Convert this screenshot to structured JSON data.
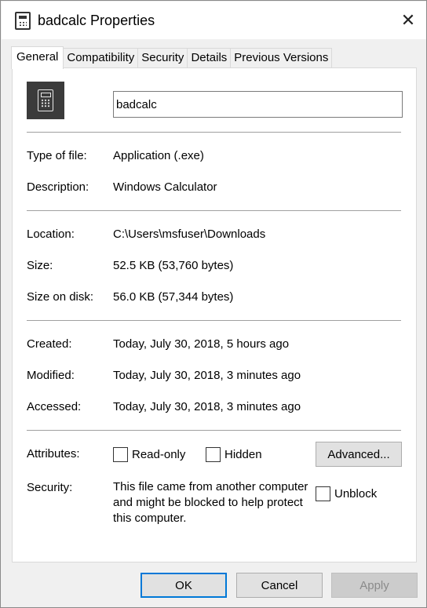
{
  "window": {
    "title": "badcalc Properties",
    "close_symbol": "✕"
  },
  "tabs": [
    {
      "label": "General",
      "active": true
    },
    {
      "label": "Compatibility",
      "active": false
    },
    {
      "label": "Security",
      "active": false
    },
    {
      "label": "Details",
      "active": false
    },
    {
      "label": "Previous Versions",
      "active": false
    }
  ],
  "general": {
    "file_name": "badcalc",
    "file_icon": "calculator-icon",
    "type_of_file": {
      "label": "Type of file:",
      "value": "Application (.exe)"
    },
    "description": {
      "label": "Description:",
      "value": "Windows Calculator"
    },
    "location": {
      "label": "Location:",
      "value": "C:\\Users\\msfuser\\Downloads"
    },
    "size": {
      "label": "Size:",
      "value": "52.5 KB (53,760 bytes)"
    },
    "size_on_disk": {
      "label": "Size on disk:",
      "value": "56.0 KB (57,344 bytes)"
    },
    "created": {
      "label": "Created:",
      "value": "Today, July 30, 2018, 5 hours ago"
    },
    "modified": {
      "label": "Modified:",
      "value": "Today, July 30, 2018, 3 minutes ago"
    },
    "accessed": {
      "label": "Accessed:",
      "value": "Today, July 30, 2018, 3 minutes ago"
    },
    "attributes": {
      "label": "Attributes:",
      "read_only": {
        "label": "Read-only",
        "checked": false
      },
      "hidden": {
        "label": "Hidden",
        "checked": false
      },
      "advanced_label": "Advanced..."
    },
    "security": {
      "label": "Security:",
      "text": "This file came from another computer and might be blocked to help protect this computer.",
      "unblock": {
        "label": "Unblock",
        "checked": false
      }
    }
  },
  "footer": {
    "ok_label": "OK",
    "cancel_label": "Cancel",
    "apply_label": "Apply"
  },
  "colors": {
    "accent": "#0078d7",
    "panel": "#ffffff",
    "chrome": "#f0f0f0"
  }
}
